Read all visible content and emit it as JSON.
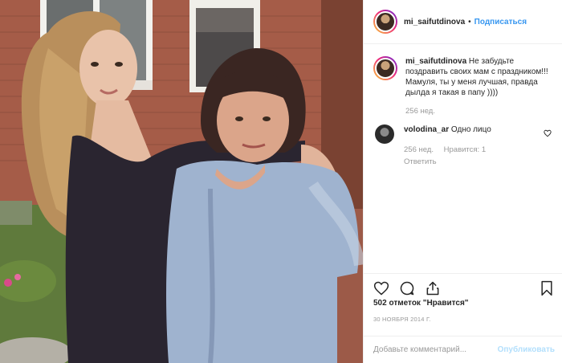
{
  "colors": {
    "accent": "#3897f0",
    "muted": "#999999",
    "publish_disabled": "#b2dffc",
    "text": "#262626"
  },
  "header": {
    "username": "mi_saifutdinova",
    "separator": "•",
    "follow_label": "Подписаться"
  },
  "caption": {
    "username": "mi_saifutdinova",
    "text": "Не забудьте поздравить своих мам с праздником!!! Мамуля, ты у меня лучшая, правда дылда я такая в папу ))))",
    "time": "256 нед."
  },
  "comments": [
    {
      "username": "volodina_ar",
      "text": "Одно лицо",
      "time": "256 нед.",
      "likes": "Нравится: 1",
      "reply_label": "Ответить"
    }
  ],
  "actions": {
    "like_icon": "heart-icon",
    "comment_icon": "comment-icon",
    "share_icon": "share-icon",
    "save_icon": "bookmark-icon"
  },
  "likes_text": "502 отметок \"Нравится\"",
  "date": "30 НОЯБРЯ 2014 Г.",
  "add_comment": {
    "placeholder": "Добавьте комментарий...",
    "publish_label": "Опубликовать"
  }
}
